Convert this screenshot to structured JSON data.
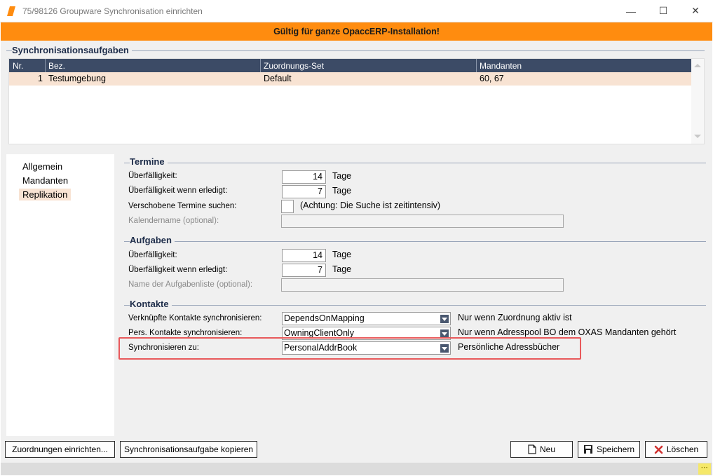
{
  "window": {
    "title": "75/98126 Groupware Synchronisation einrichten",
    "minimize_glyph": "—",
    "maximize_glyph": "☐",
    "close_glyph": "✕"
  },
  "banner": {
    "text": "Gültig für ganze OpaccERP-Installation!"
  },
  "tasks": {
    "title": "Synchronisationsaufgaben",
    "columns": [
      "Nr.",
      "Bez.",
      "Zuordnungs-Set",
      "Mandanten"
    ],
    "rows": [
      {
        "nr": "1",
        "bez": "Testumgebung",
        "set": "Default",
        "mandanten": "60, 67"
      }
    ]
  },
  "nav": {
    "items": [
      "Allgemein",
      "Mandanten",
      "Replikation"
    ],
    "selected": "Replikation"
  },
  "termine": {
    "title": "Termine",
    "overdue_label": "Überfälligkeit:",
    "overdue_value": "14",
    "overdue_unit": "Tage",
    "overdue_done_label": "Überfälligkeit wenn erledigt:",
    "overdue_done_value": "7",
    "overdue_done_unit": "Tage",
    "moved_label": "Verschobene Termine suchen:",
    "moved_hint": "(Achtung: Die Suche ist zeitintensiv)",
    "calendar_label": "Kalendername (optional):",
    "calendar_value": ""
  },
  "aufgaben": {
    "title": "Aufgaben",
    "overdue_label": "Überfälligkeit:",
    "overdue_value": "14",
    "overdue_unit": "Tage",
    "overdue_done_label": "Überfälligkeit wenn erledigt:",
    "overdue_done_value": "7",
    "overdue_done_unit": "Tage",
    "list_label": "Name der Aufgabenliste (optional):",
    "list_value": ""
  },
  "kontakte": {
    "title": "Kontakte",
    "linked_label": "Verknüpfte Kontakte synchronisieren:",
    "linked_value": "DependsOnMapping",
    "linked_hint": "Nur wenn Zuordnung aktiv ist",
    "personal_label": "Pers. Kontakte synchronisieren:",
    "personal_value": "OwningClientOnly",
    "personal_hint": "Nur wenn Adresspool BO dem OXAS Mandanten gehört",
    "target_label": "Synchronisieren zu:",
    "target_value": "PersonalAddrBook",
    "target_hint": "Persönliche Adressbücher"
  },
  "buttons": {
    "mapping": "Zuordnungen einrichten...",
    "copy": "Synchronisationsaufgabe kopieren",
    "new": "Neu",
    "save": "Speichern",
    "delete": "Löschen"
  },
  "colors": {
    "banner": "#ff8c0f",
    "grid_header": "#3c4b66",
    "selection": "#f8e3d3",
    "highlight_box": "#e8595b",
    "delete_icon": "#d0302f"
  }
}
